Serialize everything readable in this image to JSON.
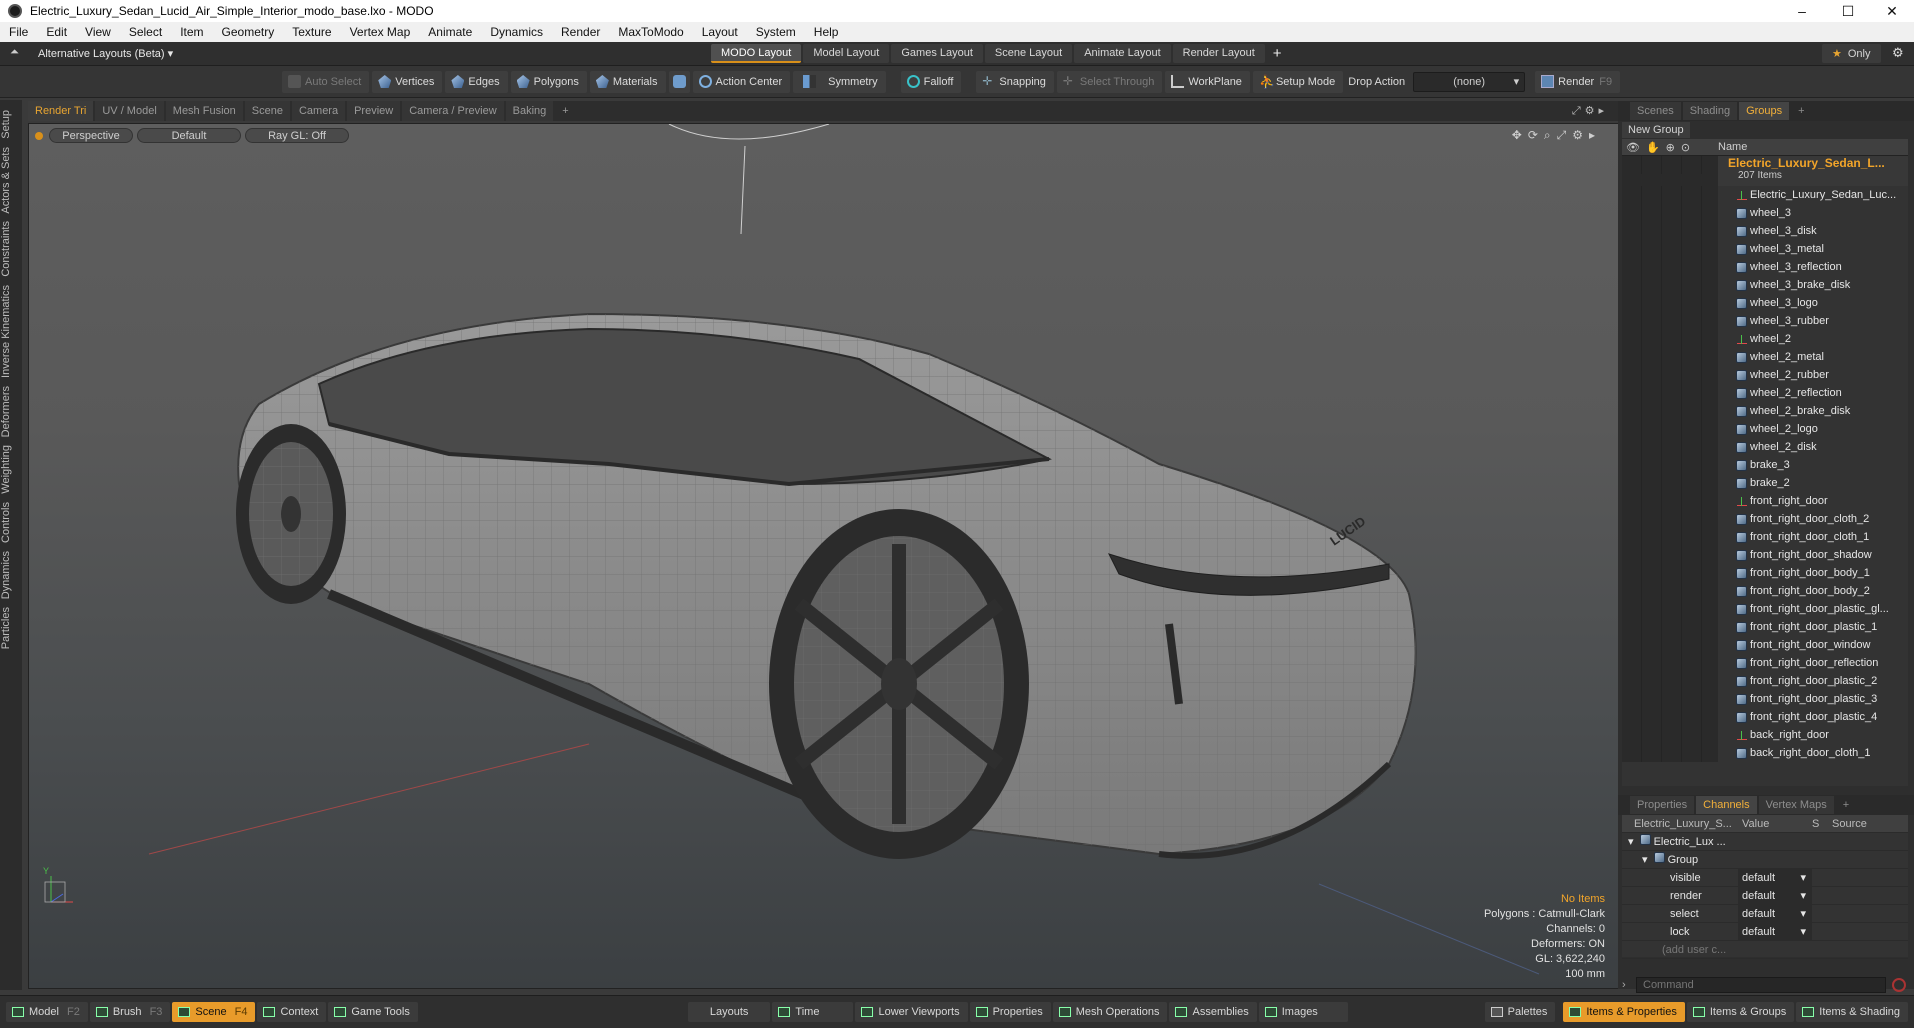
{
  "window": {
    "title": "Electric_Luxury_Sedan_Lucid_Air_Simple_Interior_modo_base.lxo - MODO",
    "controls": [
      "–",
      "☐",
      "✕"
    ]
  },
  "menu": [
    "File",
    "Edit",
    "View",
    "Select",
    "Item",
    "Geometry",
    "Texture",
    "Vertex Map",
    "Animate",
    "Dynamics",
    "Render",
    "MaxToModo",
    "Layout",
    "System",
    "Help"
  ],
  "layoutbar": {
    "selector": "Alternative Layouts (Beta)",
    "tabs": [
      "MODO Layout",
      "Model Layout",
      "Games Layout",
      "Scene Layout",
      "Animate Layout",
      "Render Layout"
    ],
    "active": "MODO Layout",
    "add": "+",
    "only": "Only"
  },
  "toolbar": {
    "auto_select": "Auto Select",
    "vertices": "Vertices",
    "edges": "Edges",
    "polygons": "Polygons",
    "materials": "Materials",
    "action_center": "Action Center",
    "symmetry": "Symmetry",
    "falloff": "Falloff",
    "snapping": "Snapping",
    "select_through": "Select Through",
    "workplane": "WorkPlane",
    "setup_mode": "Setup Mode",
    "drop_action": "Drop Action",
    "drop_value": "(none)",
    "render": "Render",
    "render_key": "F9"
  },
  "left_tabs": [
    "Setup",
    "Actors & Sets",
    "Constraints",
    "Inverse Kinematics",
    "Deformers",
    "Weighting",
    "Controls",
    "Dynamics",
    "Particles"
  ],
  "viewport_tabs": [
    "Render Tri",
    "UV / Model",
    "Mesh Fusion",
    "Scene",
    "Camera",
    "Preview",
    "Camera / Preview",
    "Baking",
    "+"
  ],
  "viewport": {
    "view": "Perspective",
    "style": "Default",
    "raygl": "Ray GL: Off",
    "brand_text": "LUCID",
    "info": {
      "items": "No Items",
      "polygons": "Polygons : Catmull-Clark",
      "channels": "Channels: 0",
      "deformers": "Deformers: ON",
      "gl": "GL: 3,622,240",
      "unit": "100 mm"
    },
    "axis": {
      "y": "Y"
    }
  },
  "groups_panel": {
    "tabs": [
      "Scenes",
      "Shading",
      "Groups",
      "+"
    ],
    "active": "Groups",
    "new_group": "New Group",
    "col_name": "Name",
    "group_name": "Electric_Luxury_Sedan_L...",
    "group_count": "207 Items",
    "items": [
      {
        "name": "Electric_Luxury_Sedan_Luc...",
        "type": "locator"
      },
      {
        "name": "wheel_3",
        "type": "mesh"
      },
      {
        "name": "wheel_3_disk",
        "type": "mesh"
      },
      {
        "name": "wheel_3_metal",
        "type": "mesh"
      },
      {
        "name": "wheel_3_reflection",
        "type": "mesh"
      },
      {
        "name": "wheel_3_brake_disk",
        "type": "mesh"
      },
      {
        "name": "wheel_3_logo",
        "type": "mesh"
      },
      {
        "name": "wheel_3_rubber",
        "type": "mesh"
      },
      {
        "name": "wheel_2",
        "type": "locator"
      },
      {
        "name": "wheel_2_metal",
        "type": "mesh"
      },
      {
        "name": "wheel_2_rubber",
        "type": "mesh"
      },
      {
        "name": "wheel_2_reflection",
        "type": "mesh"
      },
      {
        "name": "wheel_2_brake_disk",
        "type": "mesh"
      },
      {
        "name": "wheel_2_logo",
        "type": "mesh"
      },
      {
        "name": "wheel_2_disk",
        "type": "mesh"
      },
      {
        "name": "brake_3",
        "type": "mesh"
      },
      {
        "name": "brake_2",
        "type": "mesh"
      },
      {
        "name": "front_right_door",
        "type": "locator"
      },
      {
        "name": "front_right_door_cloth_2",
        "type": "mesh"
      },
      {
        "name": "front_right_door_cloth_1",
        "type": "mesh"
      },
      {
        "name": "front_right_door_shadow",
        "type": "mesh"
      },
      {
        "name": "front_right_door_body_1",
        "type": "mesh"
      },
      {
        "name": "front_right_door_body_2",
        "type": "mesh"
      },
      {
        "name": "front_right_door_plastic_gl...",
        "type": "mesh"
      },
      {
        "name": "front_right_door_plastic_1",
        "type": "mesh"
      },
      {
        "name": "front_right_door_window",
        "type": "mesh"
      },
      {
        "name": "front_right_door_reflection",
        "type": "mesh"
      },
      {
        "name": "front_right_door_plastic_2",
        "type": "mesh"
      },
      {
        "name": "front_right_door_plastic_3",
        "type": "mesh"
      },
      {
        "name": "front_right_door_plastic_4",
        "type": "mesh"
      },
      {
        "name": "back_right_door",
        "type": "locator"
      },
      {
        "name": "back_right_door_cloth_1",
        "type": "mesh"
      }
    ]
  },
  "channels_panel": {
    "tabs": [
      "Properties",
      "Channels",
      "Vertex Maps",
      "+"
    ],
    "active": "Channels",
    "headers": {
      "name": "Electric_Luxury_S...",
      "value": "Value",
      "s": "S",
      "source": "Source"
    },
    "root": "Electric_Lux ...",
    "group": "Group",
    "rows": [
      {
        "name": "visible",
        "value": "default"
      },
      {
        "name": "render",
        "value": "default"
      },
      {
        "name": "select",
        "value": "default"
      },
      {
        "name": "lock",
        "value": "default"
      }
    ],
    "add_user": "(add user c...",
    "command_placeholder": "Command"
  },
  "statusbar": {
    "left": [
      {
        "label": "Model",
        "key": "F2"
      },
      {
        "label": "Brush",
        "key": "F3"
      },
      {
        "label": "Scene",
        "key": "F4",
        "active": true
      },
      {
        "label": "Context",
        "key": ""
      },
      {
        "label": "Game Tools",
        "key": ""
      }
    ],
    "center": [
      "Layouts",
      "Time",
      "Lower Viewports",
      "Properties",
      "Mesh Operations",
      "Assemblies",
      "Images"
    ],
    "right": [
      "Palettes",
      "Items & Properties",
      "Items & Groups",
      "Items & Shading"
    ],
    "right_active": "Items & Properties"
  },
  "colors": {
    "accent": "#e89b2a",
    "group_name": "#f2a52a",
    "bg": "#3a3a3a"
  }
}
